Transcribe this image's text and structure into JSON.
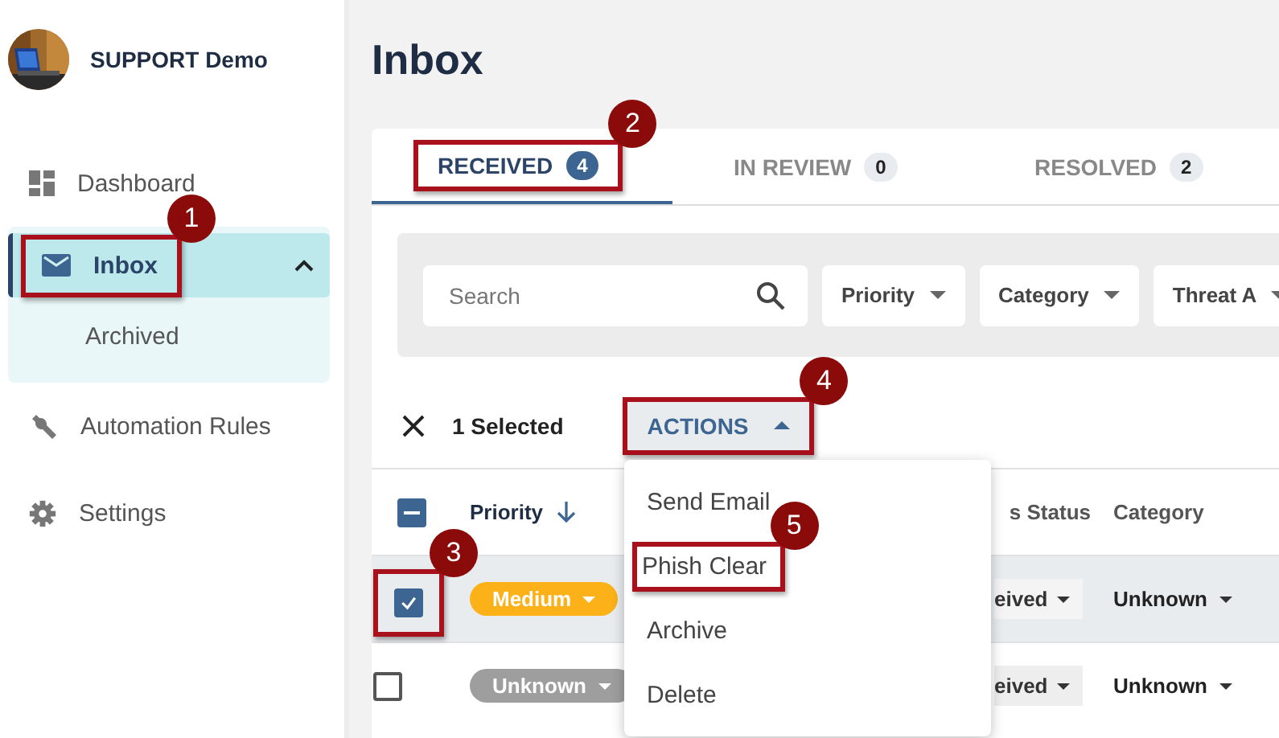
{
  "sidebar": {
    "org_name": "SUPPORT Demo",
    "nav": [
      {
        "label": "Dashboard",
        "kind": "dashboard",
        "selected": false
      },
      {
        "label": "Inbox",
        "kind": "mail",
        "selected": true,
        "expanded": true,
        "callout": "1",
        "children": [
          {
            "label": "Archived",
            "selected": false
          }
        ]
      },
      {
        "label": "Automation Rules",
        "kind": "wrench",
        "selected": false
      },
      {
        "label": "Settings",
        "kind": "gear",
        "selected": false
      }
    ]
  },
  "page_title": "Inbox",
  "tabs": [
    {
      "label": "RECEIVED",
      "count": "4",
      "selected": true,
      "callout": "2"
    },
    {
      "label": "IN REVIEW",
      "count": "0",
      "selected": false
    },
    {
      "label": "RESOLVED",
      "count": "2",
      "selected": false
    }
  ],
  "filters": {
    "search_placeholder": "Search",
    "dropdowns": [
      "Priority",
      "Category",
      "Threat A"
    ]
  },
  "selection": {
    "count_text": "1 Selected",
    "actions_button": "ACTIONS",
    "menu_open": true,
    "callout": "4"
  },
  "actions_menu": [
    {
      "label": "Send Email"
    },
    {
      "label": "Phish Clear",
      "callout": "5"
    },
    {
      "label": "Archive"
    },
    {
      "label": "Delete"
    }
  ],
  "table": {
    "select_all_checked": true,
    "select_all_indeterminate": true,
    "columns": [
      {
        "label": "Priority",
        "sorted": true
      },
      {
        "label": "s Status",
        "sorted": false
      },
      {
        "label": "Category",
        "sorted": false
      }
    ],
    "rows": [
      {
        "checked": true,
        "callout": "3",
        "priority": "Medium",
        "color": "#fbb117",
        "status": "eived",
        "category": "Unknown"
      },
      {
        "checked": false,
        "priority": "Unknown",
        "color": "#9e9e9e",
        "status": "eived",
        "category": "Unknown"
      }
    ]
  }
}
